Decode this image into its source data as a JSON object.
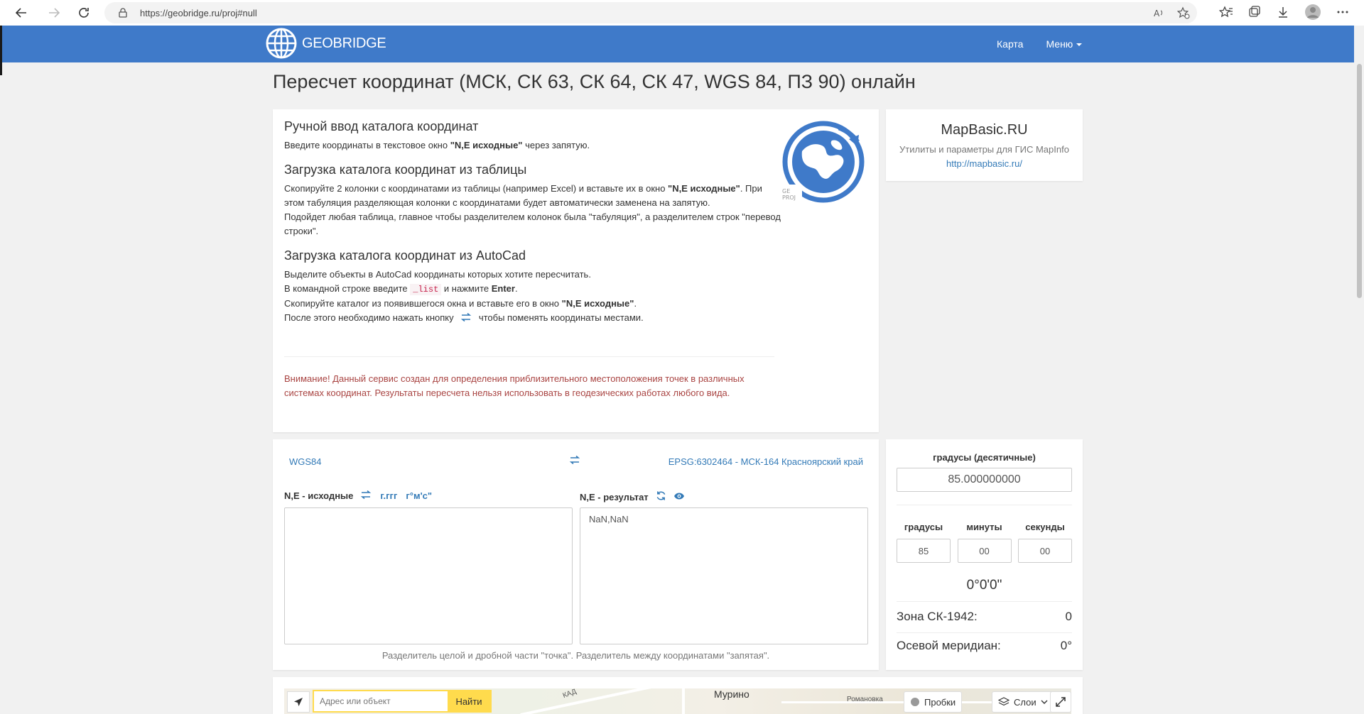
{
  "browser": {
    "url": "https://geobridge.ru/proj#null"
  },
  "header": {
    "logo_text": "GEOBRIDGE",
    "nav": {
      "map": "Карта",
      "menu": "Меню"
    }
  },
  "page_title": "Пересчет координат (МСК, СК 63, СК 64, СК 47, WGS 84, ПЗ 90) онлайн",
  "instructions": {
    "manual_title": "Ручной ввод каталога координат",
    "manual_text_1": "Введите координаты в текстовое окно ",
    "manual_bold": "\"N,E исходные\"",
    "manual_text_2": " через запятую.",
    "table_title": "Загрузка каталога координат из таблицы",
    "table_text_1": "Скопируйте 2 колонки с координатами из таблицы (например Excel) и вставьте их в окно ",
    "table_bold": "\"N,E исходные\"",
    "table_text_2": ". При этом табуляция разделяющая колонки с координатами будет автоматически заменена на запятую.",
    "table_text_3": "Подойдет любая таблица, главное чтобы разделителем колонок была \"табуляция\", а разделителем строк \"перевод строки\".",
    "autocad_title": "Загрузка каталога координат из AutoCad",
    "autocad_line_1": "Выделите объекты в AutoCad координаты которых хотите пересчитать.",
    "autocad_line_2a": "В командной строке введите ",
    "autocad_code": "_list",
    "autocad_line_2b": " и нажмите ",
    "autocad_enter": "Enter",
    "autocad_line_3a": "Скопируйте каталог из появившегося окна и вставьте его в окно ",
    "autocad_bold": "\"N,E исходные\"",
    "autocad_line_4a": "После этого необходимо нажать кнопку ",
    "autocad_line_4b": " чтобы поменять координаты местами.",
    "warning": "Внимание! Данный сервис создан для определения приблизительного местоположения точек в различных системах координат. Результаты пересчета нельзя использовать в геодезических работах любого вида."
  },
  "mapbasic": {
    "title": "MapBasic.RU",
    "desc": "Утилиты и параметры для ГИС MapInfo ",
    "link": "http://mapbasic.ru/"
  },
  "converter": {
    "src_crs": "WGS84",
    "dst_crs": "EPSG:6302464 - МСК-164 Красноярский край",
    "src_label": "N,E - исходные",
    "fmt_decimal": "г.ггг",
    "fmt_dms": "г°м'с\"",
    "dst_label": "N,E - результат",
    "src_value": "",
    "dst_value": "NaN,NaN",
    "hint": "Разделитель целой и дробной части \"точка\". Разделитель между координатами \"запятая\"."
  },
  "degrees": {
    "title": "градусы (десятичные)",
    "decimal_value": "85.000000000",
    "deg_label": "градусы",
    "min_label": "минуты",
    "sec_label": "секунды",
    "deg_value": "85",
    "min_value": "00",
    "sec_value": "00",
    "dms_display": "0°0'0\"",
    "zone_label": "Зона СК-1942:",
    "zone_value": "0",
    "meridian_label": "Осевой меридиан:",
    "meridian_value": "0°"
  },
  "map": {
    "search_placeholder": "Адрес или объект",
    "find_button": "Найти",
    "place_murino": "Мурино",
    "place_kad": "КАД",
    "place_romanovka": "Романовка",
    "traffic": "Пробки",
    "layers": "Слои"
  },
  "colors": {
    "header_bg": "#3f7ac9",
    "link": "#337ab7",
    "warning": "#a94442"
  }
}
